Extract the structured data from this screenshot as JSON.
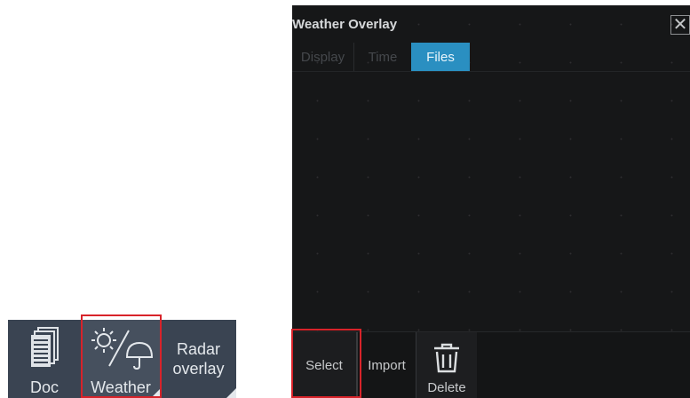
{
  "taskbar": {
    "doc_label": "Doc",
    "weather_label": "Weather",
    "radar_label_line1": "Radar",
    "radar_label_line2": "overlay"
  },
  "panel": {
    "title": "Weather Overlay",
    "close_glyph": "✕",
    "tabs": [
      {
        "label": "Display",
        "active": false
      },
      {
        "label": "Time",
        "active": false
      },
      {
        "label": "Files",
        "active": true
      }
    ],
    "bottom": {
      "select_label": "Select",
      "import_label": "Import",
      "delete_label": "Delete"
    }
  },
  "colors": {
    "highlight": "#d8232a",
    "active_tab": "#2a8fc1",
    "taskbar": "#3a4452",
    "panel_bg": "#161718"
  },
  "icons": [
    "document-icon",
    "weather-icon",
    "close-icon",
    "trash-icon"
  ]
}
